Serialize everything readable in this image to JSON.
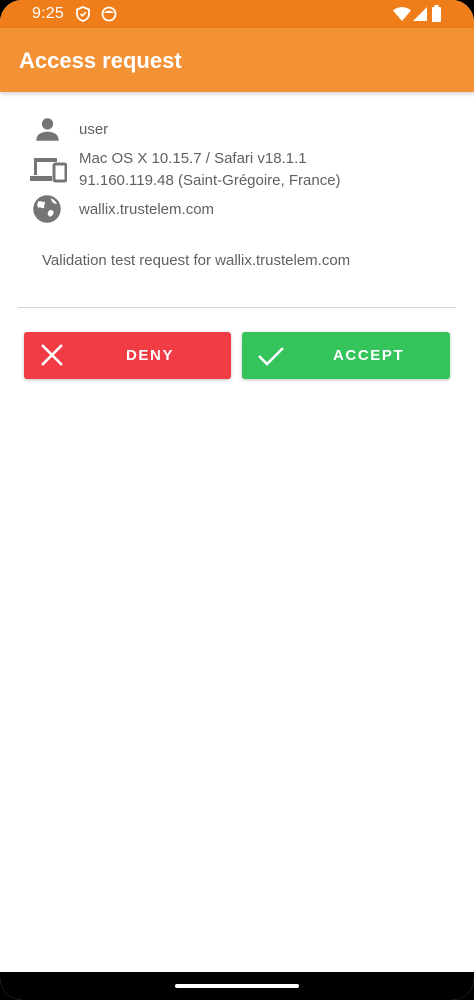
{
  "status_bar": {
    "time": "9:25",
    "icons": [
      "shield-icon",
      "face-icon",
      "wifi-icon",
      "cell-signal-icon",
      "battery-icon"
    ]
  },
  "app_bar": {
    "title": "Access request"
  },
  "request": {
    "user": "user",
    "device": "Mac OS X 10.15.7 / Safari v18.1.1",
    "ip": "91.160.119.48 (Saint-Grégoire, France)",
    "domain": "wallix.trustelem.com",
    "message": "Validation test request for wallix.trustelem.com"
  },
  "actions": {
    "deny_label": "DENY",
    "accept_label": "ACCEPT"
  },
  "colors": {
    "status_bar": "#ef7d1a",
    "app_bar": "#f39235",
    "deny": "#f23c45",
    "accept": "#35c35c",
    "text": "#606060",
    "icon": "#757575"
  }
}
